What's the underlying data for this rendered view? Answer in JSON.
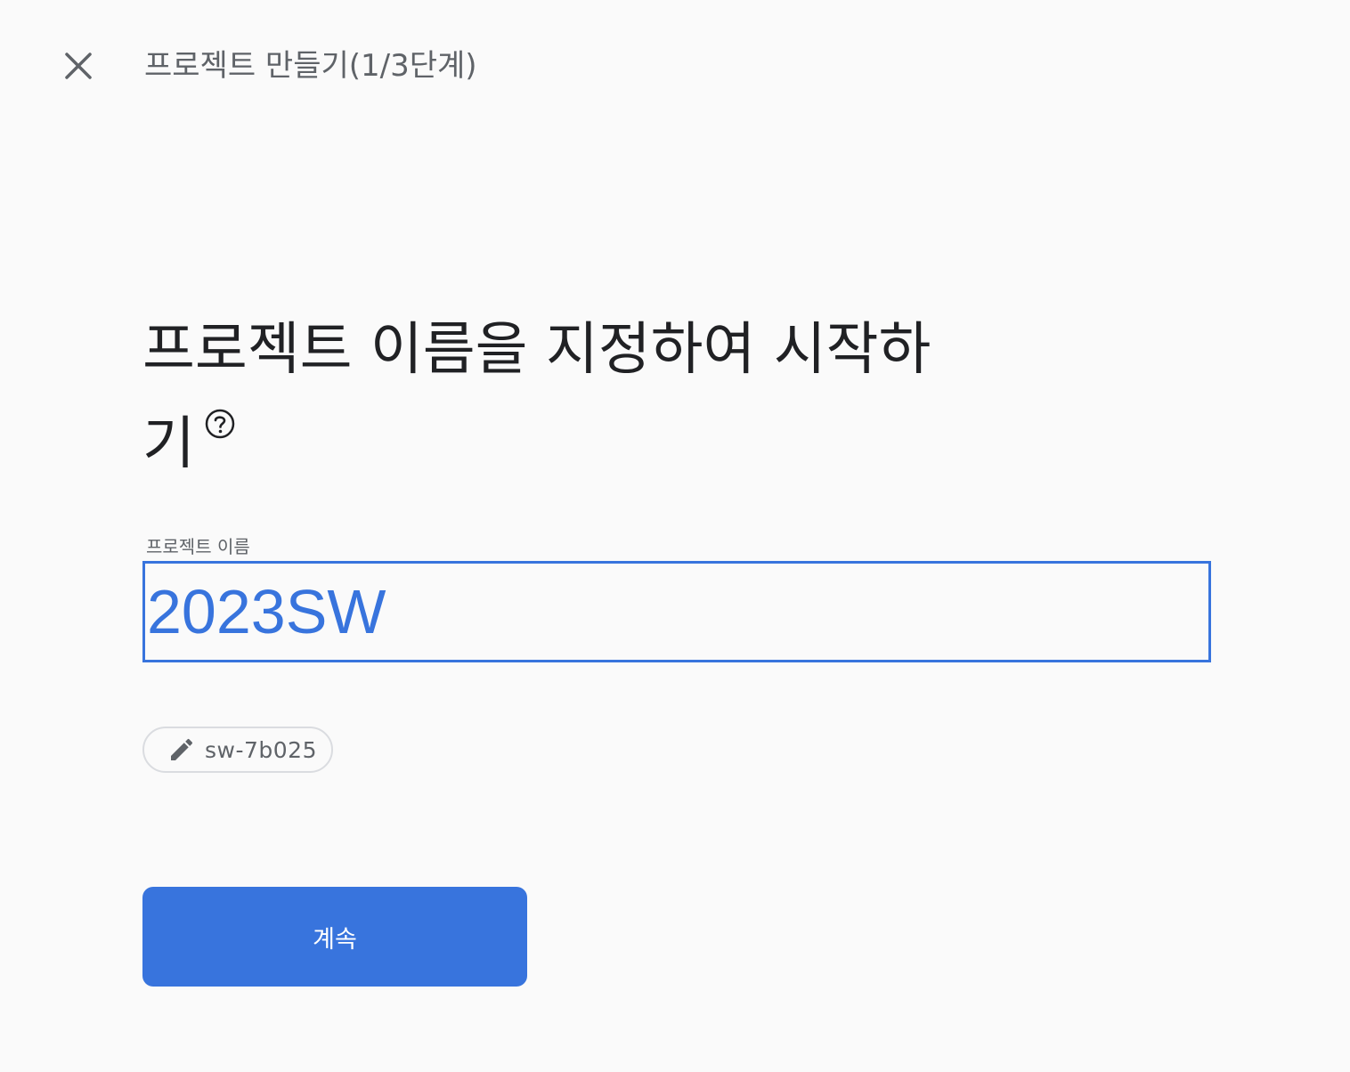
{
  "header": {
    "step_title": "프로젝트 만들기(1/3단계)",
    "close_icon": "close-icon"
  },
  "main": {
    "heading_line1": "프로젝트 이름을 지정하여 시작하",
    "heading_line2": "기",
    "help_icon": "help-circle-icon"
  },
  "form": {
    "project_name_label": "프로젝트 이름",
    "project_name_value": "2023SW",
    "project_id": "sw-7b025",
    "edit_icon": "pencil-icon"
  },
  "actions": {
    "continue_label": "계속"
  },
  "colors": {
    "accent": "#3874dd",
    "background": "#fafafa",
    "text_primary": "#202124",
    "text_secondary": "#5f6368",
    "chip_border": "#dadce0"
  }
}
